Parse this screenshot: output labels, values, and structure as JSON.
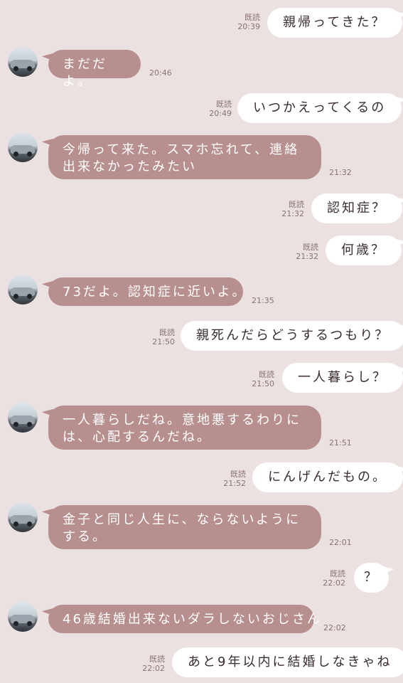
{
  "messages": [
    {
      "dir": "out",
      "text": "親帰ってきた？",
      "read": "既読",
      "time": "20:39"
    },
    {
      "dir": "in",
      "text": "まだだよ。",
      "time": "20:46"
    },
    {
      "dir": "out",
      "text": "いつかえってくるの",
      "read": "既読",
      "time": "20:49"
    },
    {
      "dir": "in",
      "text": "今帰って来た。スマホ忘れて、連絡出来なかったみたい",
      "time": "21:32"
    },
    {
      "dir": "out",
      "text": "認知症？",
      "read": "既読",
      "time": "21:32"
    },
    {
      "dir": "out",
      "text": "何歳？",
      "read": "既読",
      "time": "21:32"
    },
    {
      "dir": "in",
      "text": "73だよ。認知症に近いよ。",
      "time": "21:35"
    },
    {
      "dir": "out",
      "text": "親死んだらどうするつもり？",
      "read": "既読",
      "time": "21:50"
    },
    {
      "dir": "out",
      "text": "一人暮らし？",
      "read": "既読",
      "time": "21:50"
    },
    {
      "dir": "in",
      "text": "一人暮らしだね。意地悪するわりには、心配するんだね。",
      "time": "21:51"
    },
    {
      "dir": "out",
      "text": "にんげんだもの。",
      "read": "既読",
      "time": "21:52"
    },
    {
      "dir": "in",
      "text": "金子と同じ人生に、ならないようにする。",
      "time": "22:01"
    },
    {
      "dir": "out",
      "text": "？",
      "read": "既読",
      "time": "22:02"
    },
    {
      "dir": "in",
      "text": "46歳結婚出来ないダラしないおじさん",
      "time": "22:02"
    },
    {
      "dir": "out",
      "text": "あと9年以内に結婚しなきゃね",
      "read": "既読",
      "time": "22:02"
    }
  ],
  "colors": {
    "background": "#ebe1e0",
    "incoming_bubble": "#b88f8f",
    "outgoing_bubble": "#ffffff",
    "meta_text": "#8a7373"
  },
  "icons": {
    "avatar": "car-photo-avatar"
  }
}
